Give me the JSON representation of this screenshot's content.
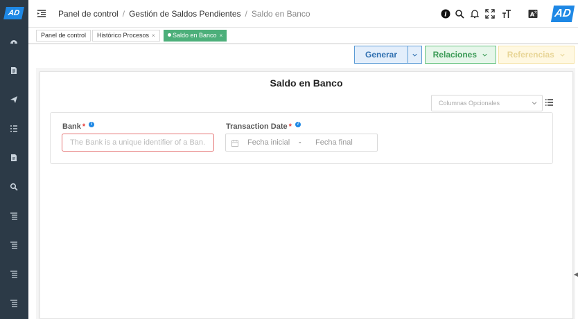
{
  "app": {
    "logo_text": "AD",
    "badge_text": "AD",
    "accent": "#1e88e5"
  },
  "breadcrumb": {
    "items": [
      "Panel de control",
      "Gestión de Saldos Pendientes"
    ],
    "current": "Saldo en Banco",
    "separator": "/"
  },
  "header_icons": [
    "info-icon",
    "search-icon",
    "bell-icon",
    "fullscreen-icon",
    "font-size-icon",
    "translate-icon"
  ],
  "sidebar": {
    "items": [
      "dashboard-icon",
      "document-icon",
      "send-icon",
      "list-icon",
      "report-icon",
      "search-icon",
      "tree-list-icon",
      "tree-list-icon",
      "tree-list-icon",
      "tree-list-icon"
    ]
  },
  "tabs": [
    {
      "label": "Panel de control",
      "closable": false,
      "active": false
    },
    {
      "label": "Histórico Procesos",
      "closable": true,
      "active": false
    },
    {
      "label": "Saldo en Banco",
      "closable": true,
      "active": true
    }
  ],
  "tab_close": "×",
  "actions": {
    "generar": "Generar",
    "relaciones": "Relaciones",
    "referencias": "Referencias"
  },
  "panel": {
    "title": "Saldo en Banco",
    "optional_columns_placeholder": "Columnas Opcionales",
    "bank": {
      "label": "Bank",
      "required_mark": "*",
      "placeholder": "The Bank is a unique identifier of a Ban."
    },
    "transaction_date": {
      "label": "Transaction Date",
      "required_mark": "*",
      "start_placeholder": "Fecha inicial",
      "separator": "-",
      "end_placeholder": "Fecha final"
    }
  }
}
